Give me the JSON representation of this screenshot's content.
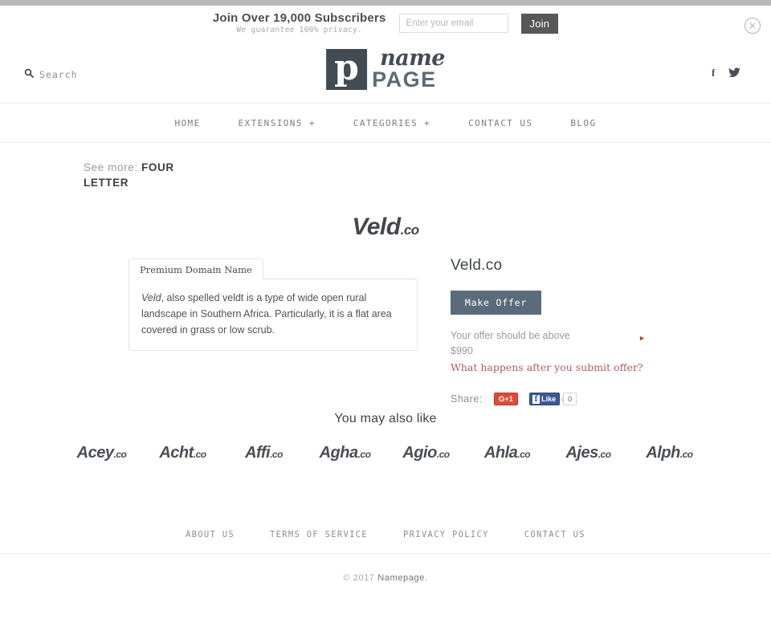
{
  "promo": {
    "headline": "Join Over 19,000 Subscribers",
    "subline": "We guarantee 100% privacy.",
    "email_placeholder": "Enter your email",
    "email_value": "",
    "join_label": "Join",
    "close_icon": "close-circle-icon"
  },
  "header": {
    "search_label": "Search",
    "search_icon": "search-icon",
    "logo": {
      "mark_letter": "p",
      "word_script": "name",
      "word_bold": "PAGE"
    },
    "social": [
      {
        "name": "facebook-icon",
        "glyph": "f"
      },
      {
        "name": "twitter-icon",
        "glyph": "bird"
      }
    ]
  },
  "nav": {
    "items": [
      {
        "label": "HOME"
      },
      {
        "label": "EXTENSIONS +"
      },
      {
        "label": "CATEGORIES +"
      },
      {
        "label": "CONTACT US"
      },
      {
        "label": "BLOG"
      }
    ]
  },
  "breadcrumb": {
    "prefix": "See more:",
    "category": "FOUR LETTER"
  },
  "hero": {
    "name": "Veld",
    "tld": ".co"
  },
  "description": {
    "tab_label": "Premium Domain Name",
    "italic_word": "Veld",
    "body": ", also spelled veldt is a type of wide open rural landscape in Southern Africa. Particularly, it is a flat area covered in grass or low scrub."
  },
  "offer": {
    "domain": "Veld.co",
    "button_label": "Make Offer",
    "hint_line1": "Your offer should be above",
    "hint_line2": "$990",
    "hint_arrow_icon": "arrow-right-icon",
    "link_label": "What happens after you submit offer?",
    "share_label": "Share:",
    "gplus_label": "G+1",
    "facebook_like_label": "Like",
    "facebook_like_count": "0",
    "accent_color": "#b25b5b",
    "button_color": "#5a6b7a"
  },
  "related": {
    "title": "You may also like",
    "items": [
      {
        "name": "Acey",
        "tld": ".co"
      },
      {
        "name": "Acht",
        "tld": ".co"
      },
      {
        "name": "Affi",
        "tld": ".co"
      },
      {
        "name": "Agha",
        "tld": ".co"
      },
      {
        "name": "Agio",
        "tld": ".co"
      },
      {
        "name": "Ahla",
        "tld": ".co"
      },
      {
        "name": "Ajes",
        "tld": ".co"
      },
      {
        "name": "Alph",
        "tld": ".co"
      }
    ]
  },
  "footer": {
    "links": [
      {
        "label": "ABOUT US"
      },
      {
        "label": "TERMS OF SERVICE"
      },
      {
        "label": "PRIVACY POLICY"
      },
      {
        "label": "CONTACT US"
      }
    ],
    "copyright_prefix": "© 2017",
    "copyright_brand": "Namepage."
  }
}
